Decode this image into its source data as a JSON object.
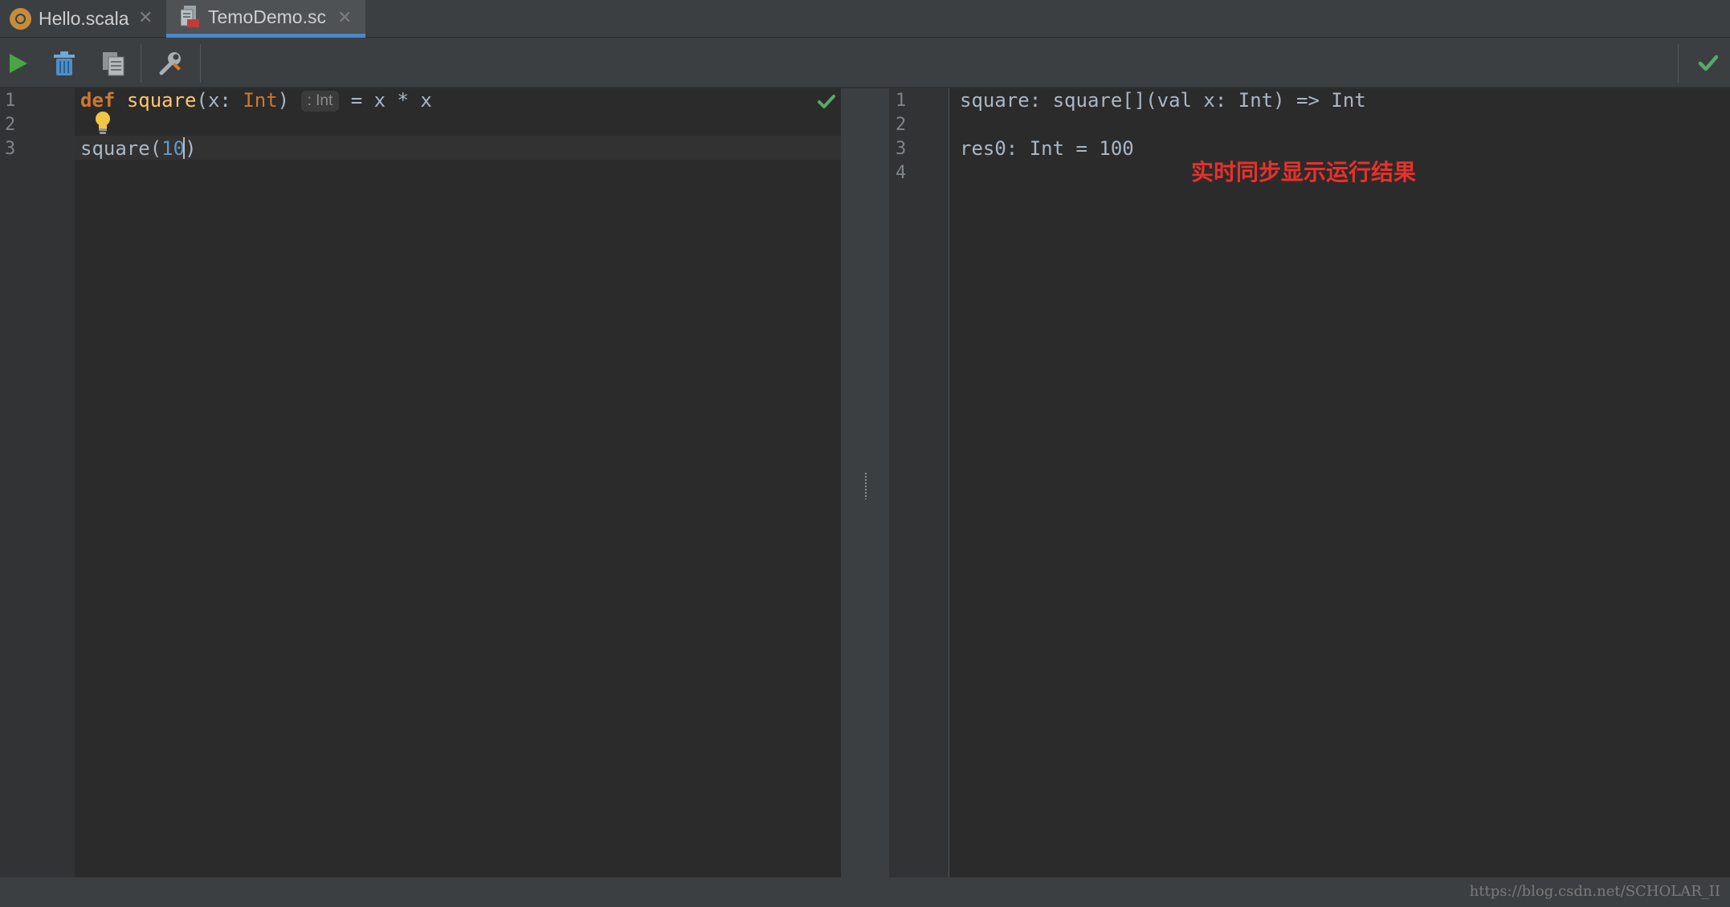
{
  "tabs": [
    {
      "label": "Hello.scala",
      "icon": "scala-file-icon",
      "active": false
    },
    {
      "label": "TemoDemo.sc",
      "icon": "worksheet-file-icon",
      "active": true
    }
  ],
  "tab_close_glyph": "✕",
  "toolbar": {
    "buttons": [
      "run-icon",
      "trash-icon",
      "copy-icon",
      "settings-icon"
    ],
    "status": "check-icon"
  },
  "editor": {
    "line_numbers": [
      "1",
      "2",
      "3"
    ],
    "line1": {
      "kw": "def",
      "fn": "square",
      "open": "(x: ",
      "type": "Int",
      "close": ")",
      "hint": ": Int",
      "rest": " = x * x"
    },
    "line3": {
      "call": "square(",
      "arg": "10",
      "close": ")"
    }
  },
  "output": {
    "line_numbers": [
      "1",
      "2",
      "3",
      "4"
    ],
    "lines": [
      "square: square[](val x: Int) => Int",
      "",
      "res0: Int = 100",
      ""
    ]
  },
  "annotation": "实时同步显示运行结果",
  "watermark": "https://blog.csdn.net/SCHOLAR_II",
  "colors": {
    "background": "#2b2b2b",
    "chrome": "#3c3f41",
    "keyword": "#cc7832",
    "function": "#ffc66d",
    "number": "#6897bb",
    "annotation": "#e8302a",
    "check": "#59a869",
    "tab_underline": "#4a88c7"
  }
}
